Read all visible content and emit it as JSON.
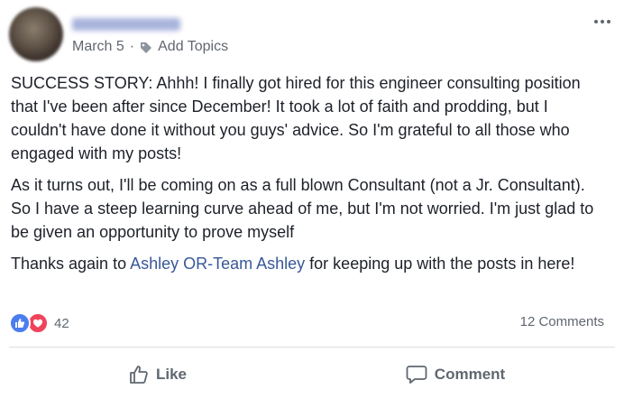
{
  "post": {
    "author_name": "",
    "date": "March 5",
    "separator": "·",
    "add_topics_label": "Add Topics",
    "paragraphs": {
      "p1": "SUCCESS STORY: Ahhh! I finally got hired for this engineer consulting position that I've been after since December! It took a lot of faith and prodding, but I couldn't have done it without you guys' advice. So I'm grateful to all those who engaged with my posts!",
      "p2": "As it turns out, I'll be coming on as a full blown Consultant (not a Jr. Consultant). So I have a steep learning curve ahead of me, but I'm not worried. I'm just glad to be given an opportunity to prove myself",
      "p3_before": "Thanks again to ",
      "p3_mention": "Ashley OR-Team Ashley",
      "p3_after": " for keeping up with the posts in here!"
    }
  },
  "reactions": {
    "count": "42",
    "types": [
      "like-icon",
      "love-icon"
    ],
    "comments_label": "12 Comments"
  },
  "actions": {
    "like_label": "Like",
    "comment_label": "Comment"
  },
  "colors": {
    "link": "#385898",
    "like": "#4c7df0",
    "love": "#f0435b",
    "muted": "#606770"
  }
}
